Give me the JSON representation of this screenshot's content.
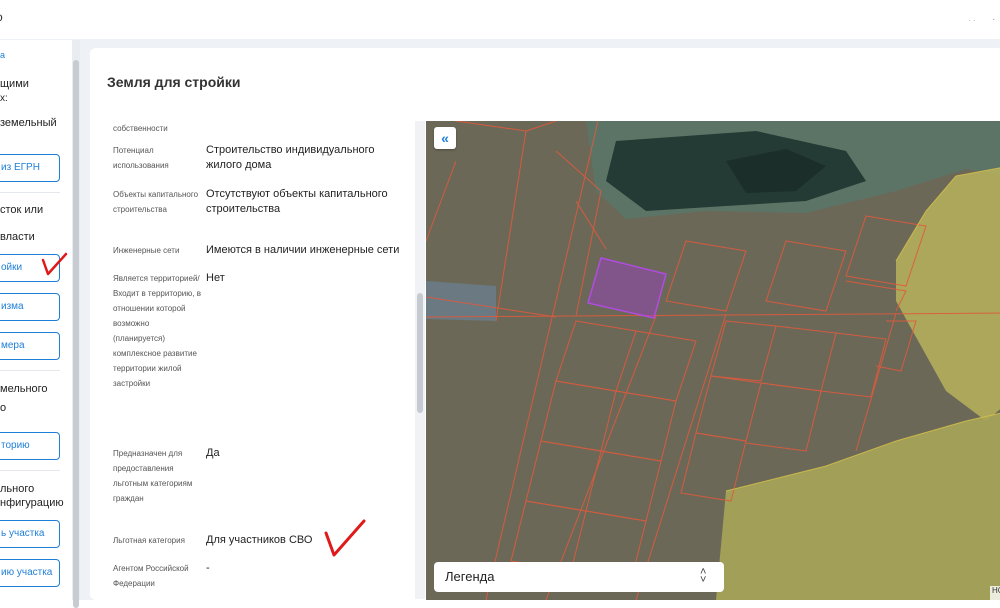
{
  "top": {
    "brand": "o"
  },
  "sidebar": {
    "items": [
      {
        "label": "а",
        "kind": "link"
      },
      {
        "label": "щими",
        "kind": "text"
      },
      {
        "label": "х:",
        "kind": "text"
      },
      {
        "label": "земельный",
        "kind": "text"
      },
      {
        "label": "из ЕГРН",
        "kind": "button"
      },
      {
        "label": "сток или",
        "kind": "text"
      },
      {
        "label": "власти",
        "kind": "text"
      },
      {
        "label": "ойки",
        "kind": "button"
      },
      {
        "label": "изма",
        "kind": "button"
      },
      {
        "label": "мера",
        "kind": "button"
      },
      {
        "label": "мельного",
        "kind": "text"
      },
      {
        "label": "о",
        "kind": "text"
      },
      {
        "label": "торию",
        "kind": "button"
      },
      {
        "label": "льного",
        "kind": "text"
      },
      {
        "label": "нфигурацию",
        "kind": "text"
      },
      {
        "label": "ь участка",
        "kind": "button"
      },
      {
        "label": "ию участка",
        "kind": "button"
      }
    ]
  },
  "card": {
    "title": "Земля для стройки"
  },
  "properties": [
    {
      "label": "собственности",
      "value": ""
    },
    {
      "label": "Потенциал использования",
      "value": "Строительство индивидуального жилого дома"
    },
    {
      "label": "Объекты капитального строительства",
      "value": "Отсутствуют объекты капитального строительства"
    },
    {
      "label": "Инженерные сети",
      "value": "Имеются в наличии инженерные сети"
    },
    {
      "label": "Является территорией/ Входит в территорию, в отношении которой возможно (планируется) комплексное развитие территории жилой застройки",
      "value": "Нет"
    },
    {
      "label": "Предназначен для предоставления льготным категориям граждан",
      "value": "Да"
    },
    {
      "label": "Льготная категория",
      "value": "Для участников СВО"
    },
    {
      "label": "Агентом Российской Федерации",
      "value": "-"
    }
  ],
  "map": {
    "collapse_icon": "«",
    "legend_label": "Легенда",
    "legend_icon": "chevron-up-down-icon",
    "attribution": "НС",
    "colors": {
      "boundary": "#e05a3c",
      "selected": "#9b3cc8",
      "zone": "#c9c23a"
    }
  }
}
